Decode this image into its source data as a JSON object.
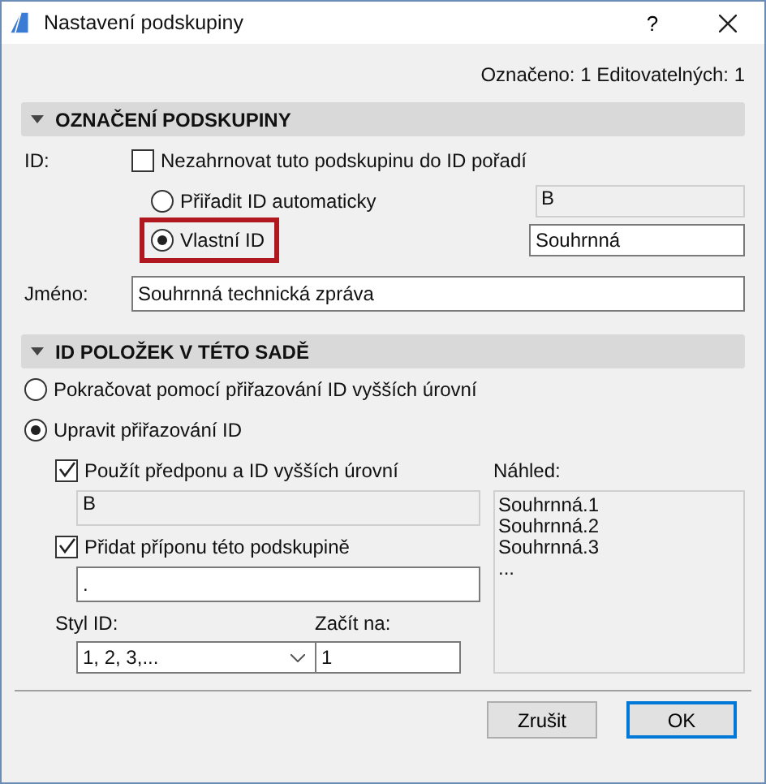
{
  "window": {
    "title": "Nastavení podskupiny",
    "help": "?"
  },
  "selection_info": "Označeno: 1 Editovatelných: 1",
  "group_section": {
    "title": "OZNAČENÍ PODSKUPINY",
    "expanded": true,
    "id_label": "ID:",
    "exclude": {
      "label": "Nezahrnovat tuto podskupinu do ID pořadí",
      "checked": false
    },
    "id_options": [
      {
        "label": "Přiřadit ID automaticky",
        "selected": false,
        "highlighted": false,
        "value": "B",
        "disabled": true
      },
      {
        "label": "Vlastní ID",
        "selected": true,
        "highlighted": true,
        "value": "Souhrnná",
        "disabled": false
      }
    ],
    "name_label": "Jméno:",
    "name_value": "Souhrnná technická zpráva"
  },
  "items_section": {
    "title": "ID POLOŽEK V TÉTO SADĚ",
    "expanded": true,
    "modes": [
      {
        "label": "Pokračovat pomocí přiřazování ID vyšších úrovní",
        "selected": false
      },
      {
        "label": "Upravit přiřazování ID",
        "selected": true
      }
    ],
    "prefix": {
      "label": "Použít předponu a ID vyšších úrovní",
      "checked": true,
      "value": "B",
      "disabled": true
    },
    "suffix": {
      "label": "Přidat příponu této podskupině",
      "checked": true,
      "value": ".",
      "disabled": false
    },
    "style_label": "Styl ID:",
    "style_value": "1, 2, 3,...",
    "start_label": "Začít na:",
    "start_value": "1",
    "preview_label": "Náhled:",
    "preview_lines": [
      "Souhrnná.1",
      "Souhrnná.2",
      "Souhrnná.3",
      "..."
    ]
  },
  "buttons": [
    {
      "label": "Zrušit",
      "default": false
    },
    {
      "label": "OK",
      "default": true
    }
  ]
}
